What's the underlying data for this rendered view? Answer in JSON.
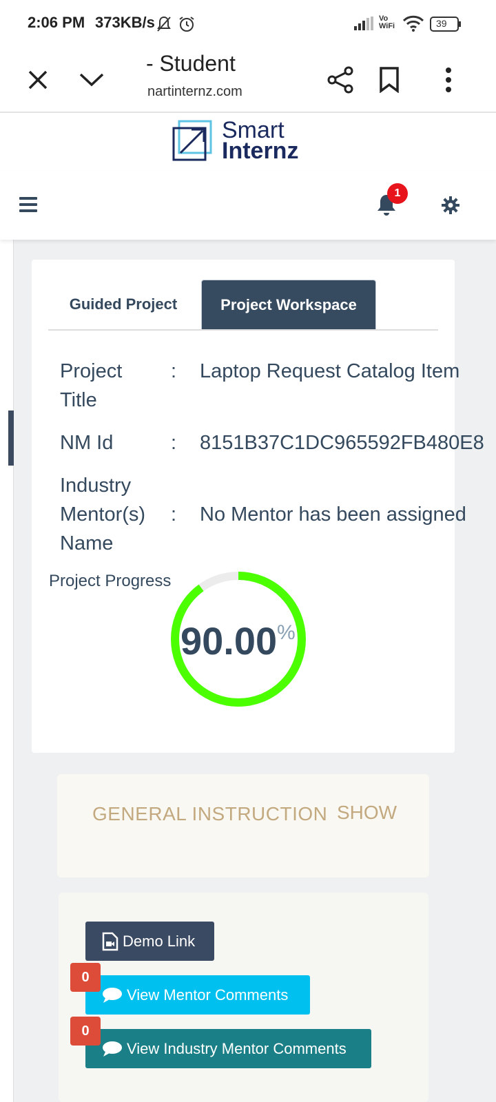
{
  "status_bar": {
    "time": "2:06 PM",
    "speed": "373KB/s",
    "network": "Vo WiFi",
    "battery": "39"
  },
  "browser": {
    "title": "- Student",
    "url": "nartinternz.com"
  },
  "logo": {
    "line1": "Smart",
    "line2": "Internz"
  },
  "navbar": {
    "notification_count": "1"
  },
  "tabs": [
    {
      "label": "Guided Project",
      "active": false
    },
    {
      "label": "Project Workspace",
      "active": true
    }
  ],
  "project_info": {
    "title_label": "Project",
    "title_label2": "Title",
    "title_value": "Laptop Request Catalog Item",
    "nm_label": "NM Id",
    "nm_value": "8151B37C1DC965592FB480E8",
    "mentor_label1": "Industry",
    "mentor_label2": "Mentor(s)",
    "mentor_label3": "Name",
    "mentor_value": "No Mentor has been assigned",
    "colon": ":"
  },
  "progress": {
    "label": "Project Progress",
    "value_text": "90.00",
    "percent_sign": "%",
    "fraction": 0.9,
    "color": "#4cff00"
  },
  "general_instruction": {
    "title": "GENERAL INSTRUCTION",
    "toggle": "SHOW"
  },
  "actions": {
    "demo_label": "Demo Link",
    "mentor_comments_label": "View Mentor Comments",
    "mentor_comments_count": "0",
    "industry_comments_label": "View Industry Mentor Comments",
    "industry_comments_count": "0"
  }
}
